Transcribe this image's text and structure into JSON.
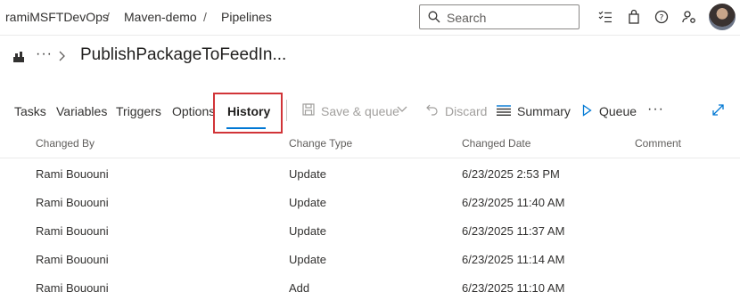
{
  "breadcrumb": {
    "org": "ramiMSFTDevOps",
    "project": "Maven-demo",
    "section": "Pipelines",
    "separator": "/"
  },
  "search": {
    "placeholder": "Search"
  },
  "header_icons": [
    "checklist-icon",
    "shopping-bag-icon",
    "help-icon",
    "user-settings-icon",
    "avatar"
  ],
  "pipeline": {
    "more": "···",
    "title": "PublishPackageToFeedIn..."
  },
  "tabs": [
    {
      "label": "Tasks"
    },
    {
      "label": "Variables"
    },
    {
      "label": "Triggers"
    },
    {
      "label": "Options"
    },
    {
      "label": "History",
      "active": true
    }
  ],
  "toolbar": {
    "save_queue": "Save & queue",
    "discard": "Discard",
    "summary": "Summary",
    "queue": "Queue",
    "more": "···"
  },
  "table": {
    "columns": [
      "Changed By",
      "Change Type",
      "Changed Date",
      "Comment"
    ],
    "rows": [
      {
        "changed_by": "Rami Bououni",
        "change_type": "Update",
        "changed_date": "6/23/2025 2:53 PM",
        "comment": ""
      },
      {
        "changed_by": "Rami Bououni",
        "change_type": "Update",
        "changed_date": "6/23/2025 11:40 AM",
        "comment": ""
      },
      {
        "changed_by": "Rami Bououni",
        "change_type": "Update",
        "changed_date": "6/23/2025 11:37 AM",
        "comment": ""
      },
      {
        "changed_by": "Rami Bououni",
        "change_type": "Update",
        "changed_date": "6/23/2025 11:14 AM",
        "comment": ""
      },
      {
        "changed_by": "Rami Bououni",
        "change_type": "Add",
        "changed_date": "6/23/2025 11:10 AM",
        "comment": ""
      }
    ]
  },
  "colors": {
    "accent": "#0078d4",
    "highlight_box": "#d13438",
    "disabled": "#a19f9d"
  }
}
